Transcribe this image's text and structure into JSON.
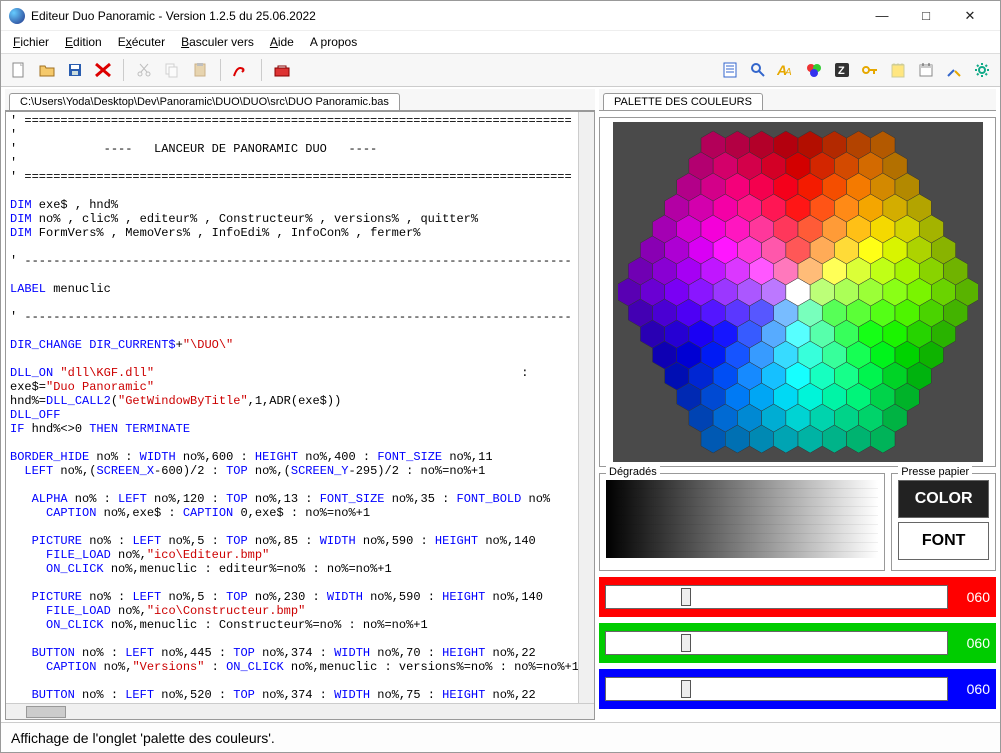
{
  "window": {
    "title": "Editeur Duo Panoramic - Version 1.2.5 du 25.06.2022"
  },
  "menu": {
    "items": [
      "Fichier",
      "Edition",
      "Exécuter",
      "Basculer vers",
      "Aide",
      "A propos"
    ]
  },
  "tabs": {
    "left": "C:\\Users\\Yoda\\Desktop\\Dev\\Panoramic\\DUO\\DUO\\src\\DUO Panoramic.bas",
    "right": "PALETTE DES COULEURS"
  },
  "code": {
    "l1": "' ============================================================================",
    "l2": "'",
    "l3": "'            ----   LANCEUR DE PANORAMIC DUO   ----",
    "l4": "'",
    "l5": "' ============================================================================",
    "d1a": "DIM",
    "d1b": " exe$ , hnd%",
    "d2a": "DIM",
    "d2b": " no% , clic% , editeur% , Constructeur% , versions% , quitter%",
    "d3a": "DIM",
    "d3b": " FormVers% , MemoVers% , InfoEdi% , InfoCon% , fermer%",
    "sep1": "' ----------------------------------------------------------------------------",
    "la1": "LABEL",
    "la1b": " menuclic",
    "sep2": "' ----------------------------------------------------------------------------",
    "dc1": "DIR_CHANGE DIR_CURRENT$",
    "dc1b": "+",
    "dc1s": "\"\\DUO\\\"",
    "dl1": "DLL_ON ",
    "dl1s": "\"dll\\KGF.dll\"",
    "dl1c": "                                                   :",
    "ex1": "exe$=",
    "ex1s": "\"Duo Panoramic\"",
    "hc1": "hnd%=",
    "hc1k": "DLL_CALL2",
    "hc1o": "(",
    "hc1s": "\"GetWindowByTitle\"",
    "hc1r": ",1,ADR(exe$))",
    "do1": "DLL_OFF",
    "if1": "IF",
    "if1b": " hnd%<>0 ",
    "if1t": "THEN TERMINATE",
    "bh1": "BORDER_HIDE",
    "bh1b": " no% : ",
    "bh1w": "WIDTH",
    "bh1c": " no%,600 : ",
    "bh1h": "HEIGHT",
    "bh1d": " no%,400 : ",
    "bh1f": "FONT_SIZE",
    "bh1e": " no%,11",
    "lf1": "  LEFT",
    "lf1b": " no%,(",
    "lf1s": "SCREEN_X",
    "lf1c": "-600)/2 : ",
    "lf1t": "TOP",
    "lf1d": " no%,(",
    "lf1y": "SCREEN_Y",
    "lf1e": "-295)/2 : no%=no%+1",
    "al1": "   ALPHA",
    "al1b": " no% : ",
    "al1l": "LEFT",
    "al1c": " no%,120 : ",
    "al1t": "TOP",
    "al1d": " no%,13 : ",
    "al1f": "FONT_SIZE",
    "al1e": " no%,35 : ",
    "al1bo": "FONT_BOLD",
    "al1n": " no%",
    "cp1": "     CAPTION",
    "cp1b": " no%,exe$ : ",
    "cp1c": "CAPTION",
    "cp1d": " 0,exe$ : no%=no%+1",
    "pc1": "   PICTURE",
    "pc1b": " no% : ",
    "pc1l": "LEFT",
    "pc1c": " no%,5 : ",
    "pc1t": "TOP",
    "pc1d": " no%,85 : ",
    "pc1w": "WIDTH",
    "pc1e": " no%,590 : ",
    "pc1h": "HEIGHT",
    "pc1f": " no%,140",
    "fl1": "     FILE_LOAD",
    "fl1b": " no%,",
    "fl1s": "\"ico\\Editeur.bmp\"",
    "oc1": "     ON_CLICK",
    "oc1b": " no%,menuclic : editeur%=no% : no%=no%+1",
    "pc2": "   PICTURE",
    "pc2b": " no% : ",
    "pc2l": "LEFT",
    "pc2c": " no%,5 : ",
    "pc2t": "TOP",
    "pc2d": " no%,230 : ",
    "pc2w": "WIDTH",
    "pc2e": " no%,590 : ",
    "pc2h": "HEIGHT",
    "pc2f": " no%,140",
    "fl2": "     FILE_LOAD",
    "fl2b": " no%,",
    "fl2s": "\"ico\\Constructeur.bmp\"",
    "oc2": "     ON_CLICK",
    "oc2b": " no%,menuclic : Constructeur%=no% : no%=no%+1",
    "bt1": "   BUTTON",
    "bt1b": " no% : ",
    "bt1l": "LEFT",
    "bt1c": " no%,445 : ",
    "bt1t": "TOP",
    "bt1d": " no%,374 : ",
    "bt1w": "WIDTH",
    "bt1e": " no%,70 : ",
    "bt1h": "HEIGHT",
    "bt1f": " no%,22",
    "cp2": "     CAPTION",
    "cp2b": " no%,",
    "cp2s": "\"Versions\"",
    "cp2c": " : ",
    "cp2o": "ON_CLICK",
    "cp2d": " no%,menuclic : versions%=no% : no%=no%+1",
    "bt2": "   BUTTON",
    "bt2b": " no% : ",
    "bt2l": "LEFT",
    "bt2c": " no%,520 : ",
    "bt2t": "TOP",
    "bt2d": " no%,374 : ",
    "bt2w": "WIDTH",
    "bt2e": " no%,75 : ",
    "bt2h": "HEIGHT",
    "bt2f": " no%,22"
  },
  "palette": {
    "gradient_label": "Dégradés",
    "press_label": "Presse papier",
    "color_btn": "COLOR",
    "font_btn": "FONT",
    "slider_r": "060",
    "slider_g": "060",
    "slider_b": "060"
  },
  "status": {
    "text": "Affichage de l'onglet 'palette des couleurs'."
  }
}
